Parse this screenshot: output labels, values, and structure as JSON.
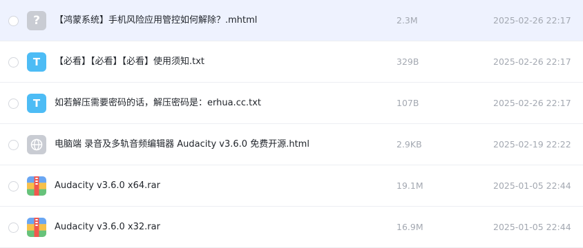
{
  "files": [
    {
      "name": "【鸿蒙系统】手机风险应用管控如何解除？.mhtml",
      "size": "2.3M",
      "date": "2025-02-26 22:17",
      "icon": "question-icon",
      "icon_glyph": "?"
    },
    {
      "name": "【必看】【必看】【必看】使用须知.txt",
      "size": "329B",
      "date": "2025-02-26 22:17",
      "icon": "txt-file-icon",
      "icon_glyph": "T"
    },
    {
      "name": "如若解压需要密码的话，解压密码是：erhua.cc.txt",
      "size": "107B",
      "date": "2025-02-26 22:17",
      "icon": "txt-file-icon",
      "icon_glyph": "T"
    },
    {
      "name": "电脑端 录音及多轨音频编辑器 Audacity v3.6.0 免费开源.html",
      "size": "2.9KB",
      "date": "2025-02-19 22:22",
      "icon": "globe-icon"
    },
    {
      "name": "Audacity v3.6.0 x64.rar",
      "size": "19.1M",
      "date": "2025-01-05 22:44",
      "icon": "rar-archive-icon"
    },
    {
      "name": "Audacity v3.6.0 x32.rar",
      "size": "16.9M",
      "date": "2025-01-05 22:44",
      "icon": "rar-archive-icon"
    }
  ],
  "colors": {
    "selected_row_bg": "#eef2fe",
    "txt_icon": "#4dbcf5",
    "generic_icon": "#c9ccd3",
    "meta_text": "#a3a8b1"
  }
}
